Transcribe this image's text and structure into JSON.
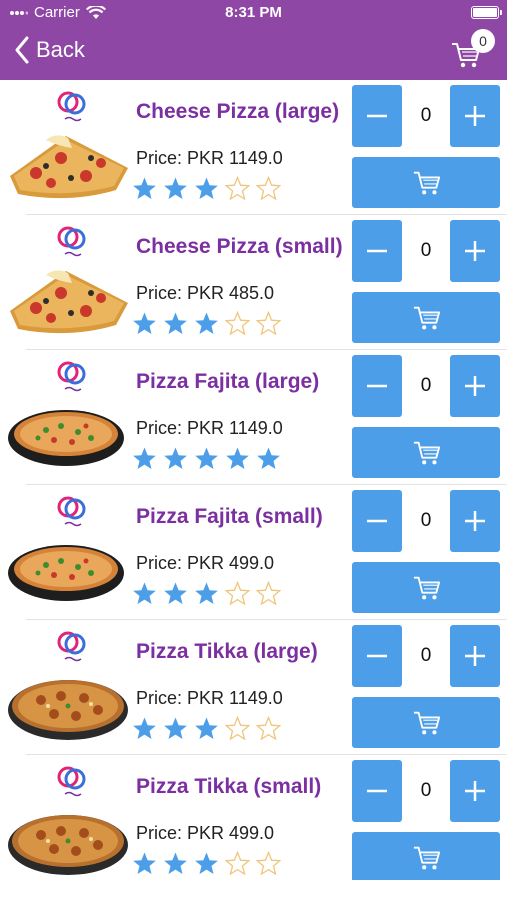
{
  "status": {
    "carrier": "Carrier",
    "time": "8:31 PM"
  },
  "nav": {
    "back_label": "Back",
    "cart_count": "0"
  },
  "colors": {
    "header": "#8f47a5",
    "accent_button": "#4d9ee8",
    "title_text": "#7b2fa0",
    "star_filled": "#4d9ee8",
    "star_empty": "#f0c57a"
  },
  "products": [
    {
      "name": "Cheese Pizza (large)",
      "price": "Price: PKR 1149.0",
      "rating": 3,
      "qty": "0",
      "image": "cheese-pizza"
    },
    {
      "name": "Cheese Pizza (small)",
      "price": "Price: PKR 485.0",
      "rating": 3,
      "qty": "0",
      "image": "cheese-pizza"
    },
    {
      "name": "Pizza Fajita (large)",
      "price": "Price: PKR 1149.0",
      "rating": 5,
      "qty": "0",
      "image": "fajita-pizza"
    },
    {
      "name": "Pizza Fajita (small)",
      "price": "Price: PKR 499.0",
      "rating": 3,
      "qty": "0",
      "image": "fajita-pizza"
    },
    {
      "name": "Pizza Tikka (large)",
      "price": "Price: PKR 1149.0",
      "rating": 3,
      "qty": "0",
      "image": "tikka-pizza"
    },
    {
      "name": "Pizza Tikka (small)",
      "price": "Price: PKR 499.0",
      "rating": 3,
      "qty": "0",
      "image": "tikka-pizza"
    }
  ]
}
